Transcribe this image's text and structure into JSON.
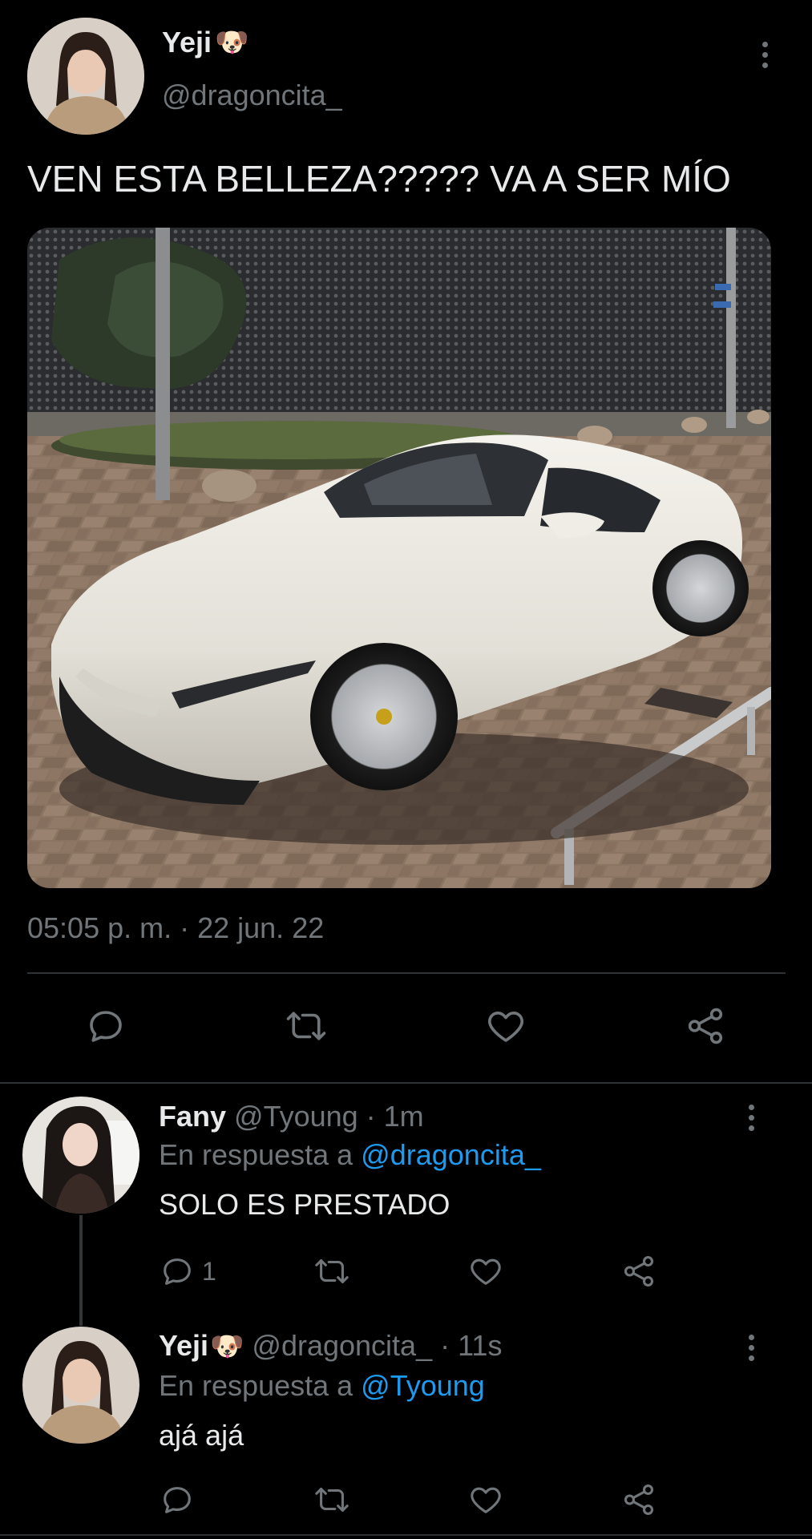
{
  "tweet": {
    "name": "Yeji",
    "name_emoji": "🐶",
    "handle": "@dragoncita_",
    "text": "VEN ESTA BELLEZA????? VA A SER MÍO",
    "timestamp": "05:05 p. m. · 22 jun. 22",
    "actions": [
      "reply-icon",
      "retweet-icon",
      "like-icon",
      "share-icon"
    ]
  },
  "replies": [
    {
      "name": "Fany",
      "handle": "@Tyoung",
      "time": "· 1m",
      "in_reply_prefix": "En respuesta a",
      "in_reply_to": "@dragoncita_",
      "text": "SOLO ES PRESTADO",
      "reply_count": "1"
    },
    {
      "name": "Yeji",
      "name_emoji": "🐶",
      "handle": "@dragoncita_",
      "time": "· 11s",
      "in_reply_prefix": "En respuesta a",
      "in_reply_to": "@Tyoung",
      "text": "ajá ajá",
      "reply_count": ""
    }
  ],
  "colors": {
    "background": "#000000",
    "text": "#e7e9ea",
    "secondary": "#71767b",
    "link": "#1d9bf0",
    "divider": "#2f3336"
  }
}
